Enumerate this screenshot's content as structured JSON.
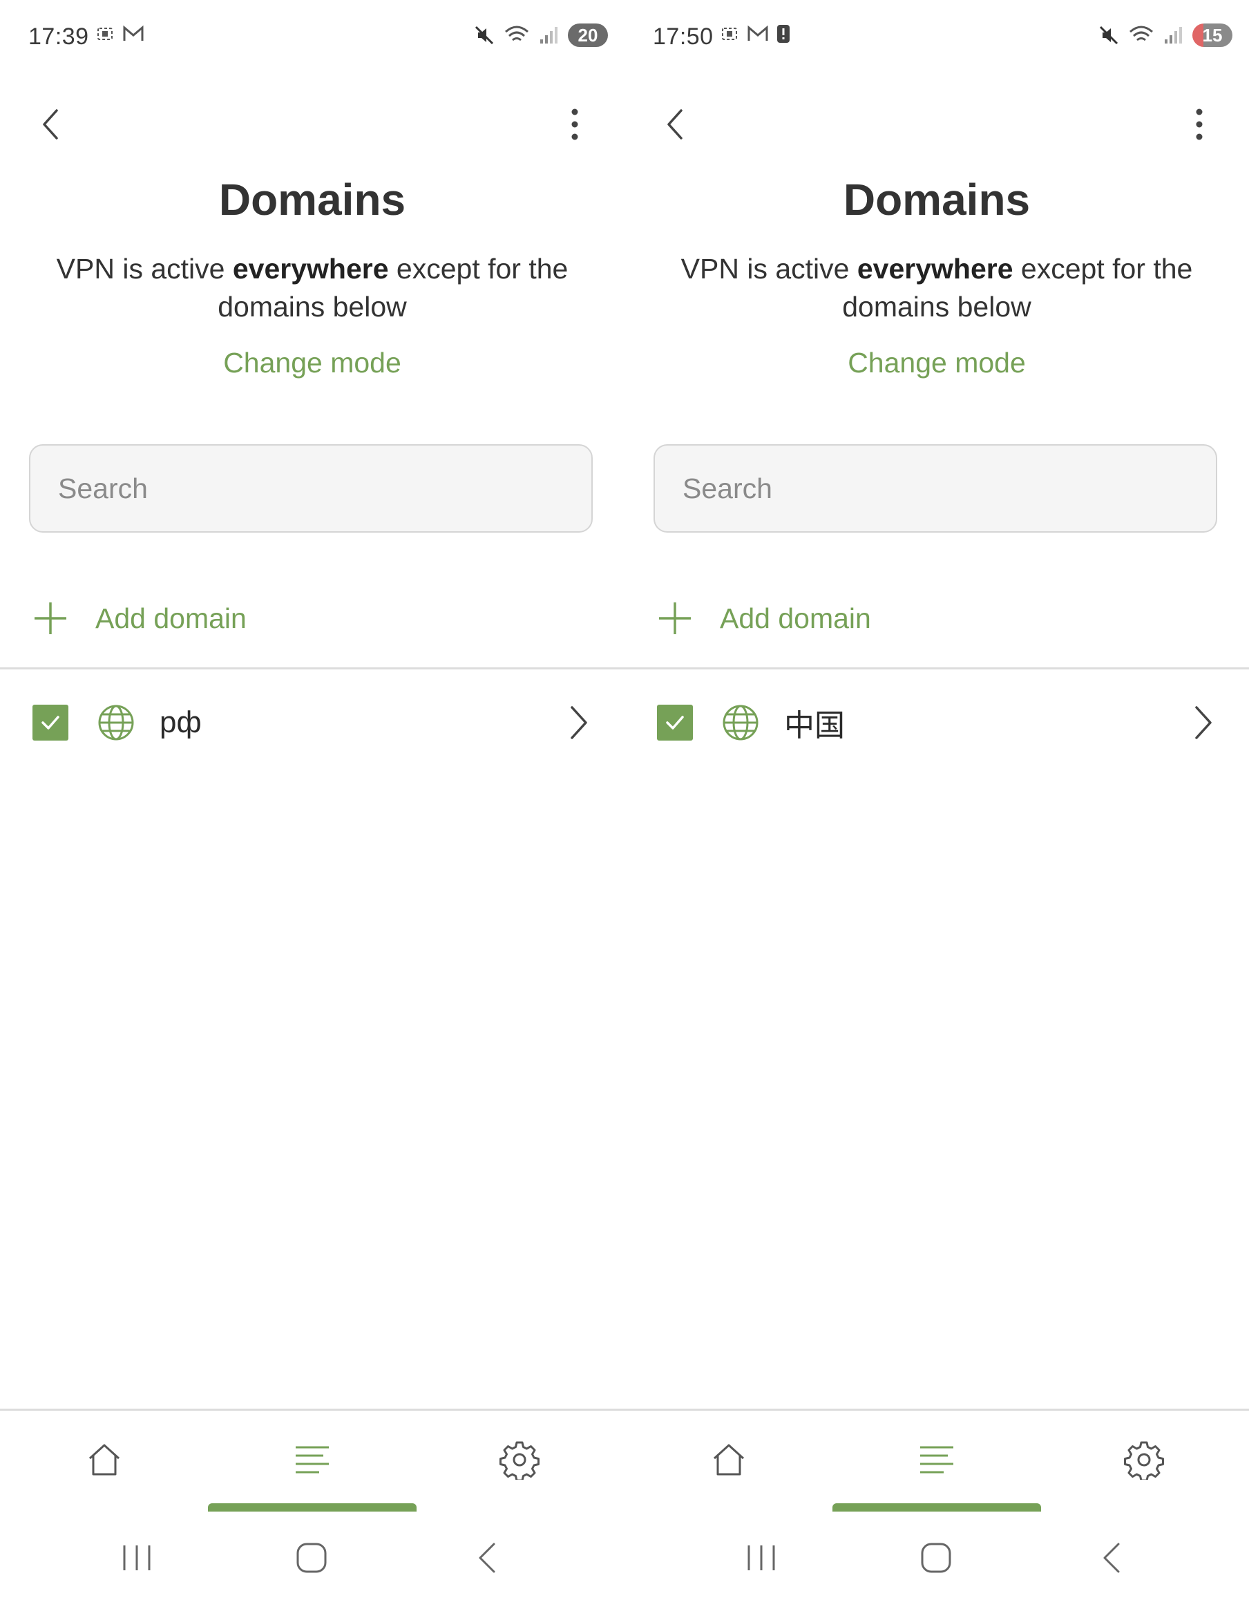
{
  "colors": {
    "accent": "#76a157",
    "text": "#2b2b2b",
    "divider": "#dcdcdc"
  },
  "screens": [
    {
      "status": {
        "time": "17:39",
        "battery": "20",
        "battery_low": false,
        "left_icons": [
          "screen-record-icon",
          "gmail-icon"
        ]
      },
      "title": "Domains",
      "description": {
        "prefix": "VPN is active ",
        "emphasis": "everywhere",
        "suffix": " except for the domains below"
      },
      "change_mode_label": "Change mode",
      "search": {
        "placeholder": "Search",
        "value": ""
      },
      "add_domain_label": "Add domain",
      "domains": [
        {
          "name": "рф",
          "checked": true
        }
      ],
      "nav": {
        "items": [
          "home-icon",
          "list-icon",
          "gear-icon"
        ],
        "active": "list-icon"
      }
    },
    {
      "status": {
        "time": "17:50",
        "battery": "15",
        "battery_low": true,
        "left_icons": [
          "screen-record-icon",
          "gmail-icon",
          "alert-icon"
        ]
      },
      "title": "Domains",
      "description": {
        "prefix": "VPN is active ",
        "emphasis": "everywhere",
        "suffix": " except for the domains below"
      },
      "change_mode_label": "Change mode",
      "search": {
        "placeholder": "Search",
        "value": ""
      },
      "add_domain_label": "Add domain",
      "domains": [
        {
          "name": "中国",
          "checked": true
        }
      ],
      "nav": {
        "items": [
          "home-icon",
          "list-icon",
          "gear-icon"
        ],
        "active": "list-icon"
      }
    }
  ]
}
